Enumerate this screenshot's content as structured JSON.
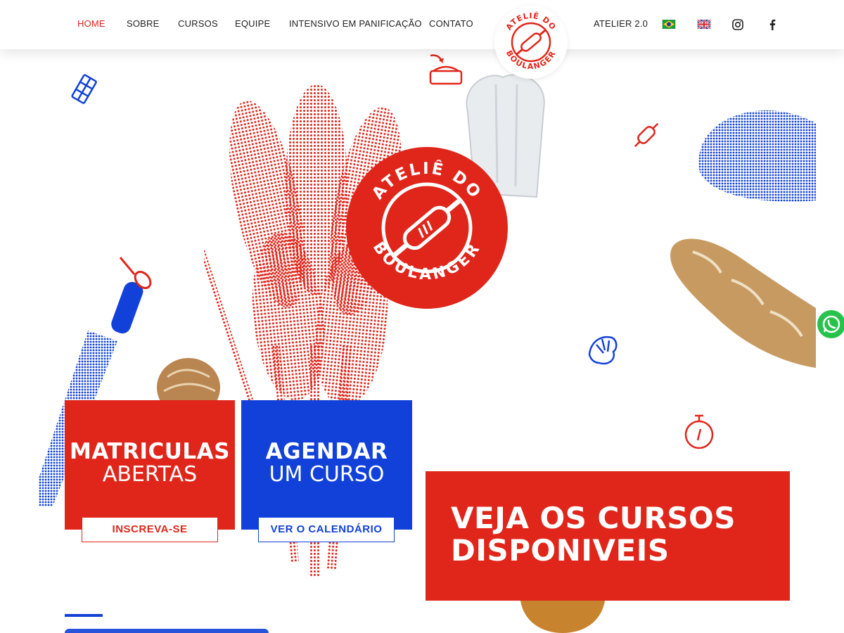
{
  "nav": {
    "items": [
      {
        "label": "HOME",
        "active": true
      },
      {
        "label": "SOBRE"
      },
      {
        "label": "CURSOS"
      },
      {
        "label": "EQUIPE"
      },
      {
        "label": "INTENSIVO EM PANIFICAÇÃO"
      },
      {
        "label": "CONTATO"
      }
    ],
    "atelier_label": "ATELIER 2.0",
    "icons": [
      "flag-brazil-icon",
      "flag-uk-icon",
      "instagram-icon",
      "facebook-icon"
    ]
  },
  "brand": {
    "logo_top": "ATELIÊ DO",
    "logo_bottom": "BOULANGER",
    "red": "#e0261b",
    "blue": "#1141d8"
  },
  "cards": {
    "matriculas": {
      "title": "MATRICULAS",
      "subtitle": "ABERTAS",
      "button": "INSCREVA-SE"
    },
    "agendar": {
      "title": "AGENDAR",
      "subtitle": "UM CURSO",
      "button": "VER O CALENDÁRIO"
    }
  },
  "cta": {
    "line1": "VEJA OS CURSOS",
    "line2": "DISPONIVEIS"
  },
  "whatsapp": {
    "icon": "whatsapp-icon"
  }
}
